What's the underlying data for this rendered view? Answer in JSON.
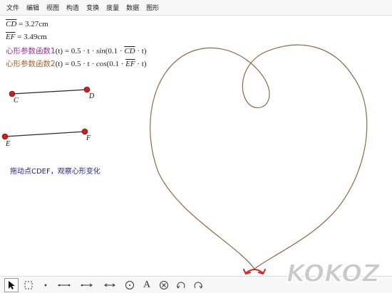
{
  "menu": [
    "文件",
    "编辑",
    "视图",
    "构造",
    "变换",
    "度量",
    "数据",
    "图形"
  ],
  "measurements": [
    {
      "name": "CD",
      "value": "= 3.27cm"
    },
    {
      "name": "EF",
      "value": "= 3.49cm"
    }
  ],
  "functions": [
    {
      "label": "心形参数函数1",
      "lhs": "(t) = 0.5 · t · ",
      "trig": "sin",
      "open": "(0.1 · ",
      "seg": "CD",
      "close": " · t)"
    },
    {
      "label": "心形参数函数2",
      "lhs": "(t) = 0.5 · t · ",
      "trig": "cos",
      "open": "(0.1 · ",
      "seg": "EF",
      "close": " · t)"
    }
  ],
  "points": {
    "C": "C",
    "D": "D",
    "E": "E",
    "F": "F"
  },
  "hint": "拖动点CDEF，观察心形变化",
  "tools": [
    "arrow-select",
    "rect-select",
    "point",
    "segment",
    "ray",
    "line",
    "circle",
    "text",
    "custom",
    "undo",
    "redo"
  ],
  "text_tool_label": "A",
  "watermark": "KOKOZ",
  "colors": {
    "curve": "#8b6a45",
    "point": "#c81e1e",
    "segment": "#2a2a2a",
    "func1": "#9b2f9b",
    "func2": "#a0662f",
    "hint": "#1b1f8a"
  }
}
